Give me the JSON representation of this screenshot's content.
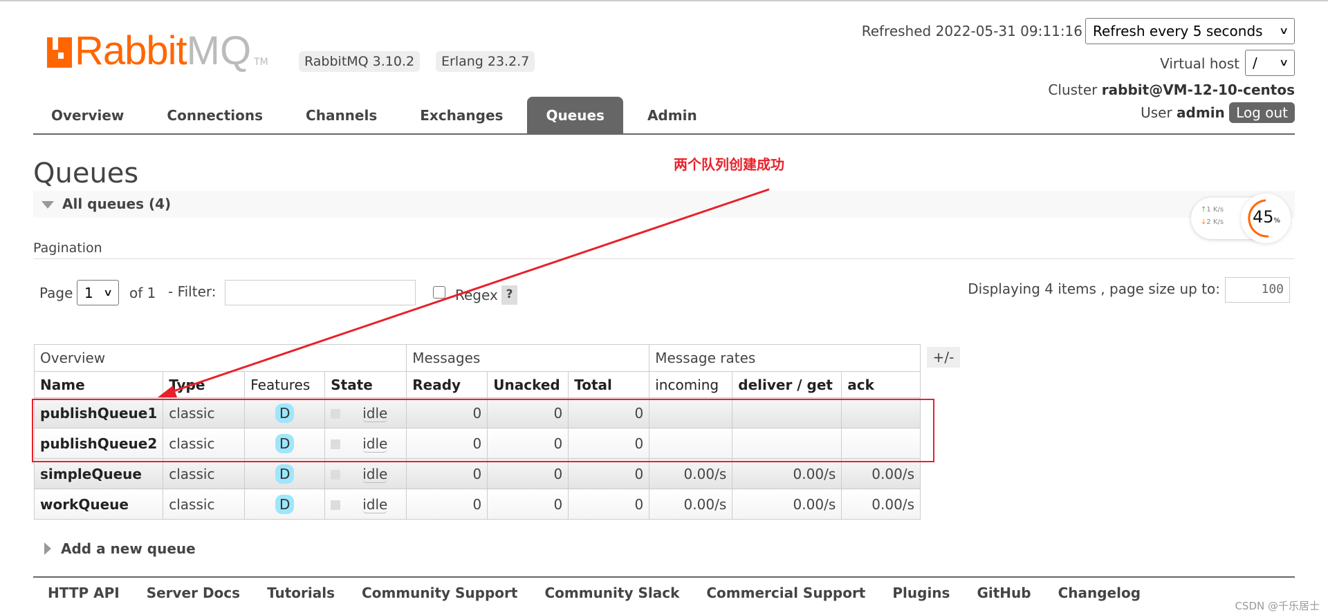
{
  "header": {
    "logo_text": "RabbitMQ",
    "version_badge": "RabbitMQ 3.10.2",
    "erlang_badge": "Erlang 23.2.7",
    "refreshed": "Refreshed 2022-05-31 09:11:16",
    "refresh_select": "Refresh every 5 seconds",
    "vhost_label": "Virtual host",
    "vhost_value": "/",
    "cluster_label": "Cluster",
    "cluster_value": "rabbit@VM-12-10-centos",
    "user_label": "User",
    "user_value": "admin",
    "logout": "Log out"
  },
  "nav": [
    "Overview",
    "Connections",
    "Channels",
    "Exchanges",
    "Queues",
    "Admin"
  ],
  "active_tab": "Queues",
  "page_title": "Queues",
  "all_queues": "All queues (4)",
  "annotation": "两个队列创建成功",
  "annotation_color": "#e8202a",
  "widget": {
    "up": "1",
    "down": "2",
    "unit": "K/s",
    "percent": "45",
    "pct_sign": "%"
  },
  "pagination": {
    "label": "Pagination",
    "page_label": "Page",
    "page_value": "1",
    "of": "of 1",
    "filter_label": "- Filter:",
    "filter_value": "",
    "regex": "Regex",
    "help": "?",
    "displaying": "Displaying 4 items , page size up to:",
    "page_size": "100"
  },
  "table": {
    "groups": [
      "Overview",
      "Messages",
      "Message rates"
    ],
    "columns": [
      "Name",
      "Type",
      "Features",
      "State",
      "Ready",
      "Unacked",
      "Total",
      "incoming",
      "deliver / get",
      "ack"
    ],
    "toggle": "+/-",
    "rows": [
      {
        "name": "publishQueue1",
        "type": "classic",
        "features": "D",
        "state": "idle",
        "ready": "0",
        "unacked": "0",
        "total": "0",
        "incoming": "",
        "deliver": "",
        "ack": ""
      },
      {
        "name": "publishQueue2",
        "type": "classic",
        "features": "D",
        "state": "idle",
        "ready": "0",
        "unacked": "0",
        "total": "0",
        "incoming": "",
        "deliver": "",
        "ack": ""
      },
      {
        "name": "simpleQueue",
        "type": "classic",
        "features": "D",
        "state": "idle",
        "ready": "0",
        "unacked": "0",
        "total": "0",
        "incoming": "0.00/s",
        "deliver": "0.00/s",
        "ack": "0.00/s"
      },
      {
        "name": "workQueue",
        "type": "classic",
        "features": "D",
        "state": "idle",
        "ready": "0",
        "unacked": "0",
        "total": "0",
        "incoming": "0.00/s",
        "deliver": "0.00/s",
        "ack": "0.00/s"
      }
    ]
  },
  "add_queue": "Add a new queue",
  "footer": [
    "HTTP API",
    "Server Docs",
    "Tutorials",
    "Community Support",
    "Community Slack",
    "Commercial Support",
    "Plugins",
    "GitHub",
    "Changelog"
  ],
  "watermark": "CSDN @千乐居士"
}
